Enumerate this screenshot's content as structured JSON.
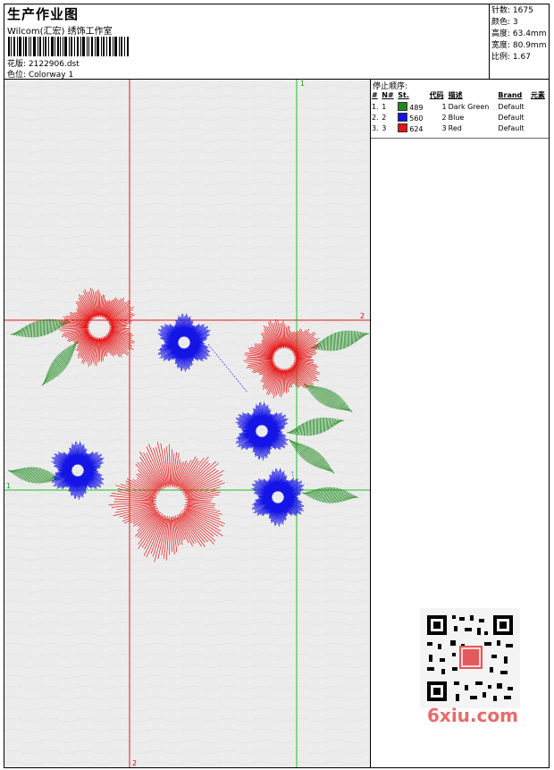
{
  "header": {
    "title": "生产作业图",
    "subtitle": "Wilcom(汇宏) 绣饰工作室",
    "design_file_label": "花版: 2122906.dst",
    "colorway_label": "色位: Colorway 1"
  },
  "stats": {
    "stitches": "针数: 1675",
    "colors": "颜色: 3",
    "height": "高度: 63.4mm",
    "width": "宽度: 80.9mm",
    "scale": "比例: 1.67"
  },
  "stop_sequence": {
    "title": "停止顺序:",
    "headers": [
      "#",
      "N#",
      "St.",
      "代码",
      "描述",
      "Brand",
      "元素"
    ],
    "rows": [
      {
        "num": "1.",
        "n": "1",
        "color": "#1f8a1f",
        "st": "489",
        "code": "1",
        "desc": "Dark Green",
        "brand": "Default"
      },
      {
        "num": "2.",
        "n": "2",
        "color": "#1414e6",
        "st": "560",
        "code": "2",
        "desc": "Blue",
        "brand": "Default"
      },
      {
        "num": "3.",
        "n": "3",
        "color": "#e61414",
        "st": "624",
        "code": "3",
        "desc": "Red",
        "brand": "Default"
      }
    ]
  },
  "guides": {
    "marker_1_top": "1",
    "marker_1_left": "1",
    "marker_2_right": "2",
    "marker_2_bottom": "2"
  },
  "watermark": "6xiu.com",
  "colors": {
    "green": "#1f8a1f",
    "blue": "#1414e6",
    "red": "#e61414",
    "guide_red": "#e31a1a",
    "guide_green": "#1fbf1f"
  }
}
